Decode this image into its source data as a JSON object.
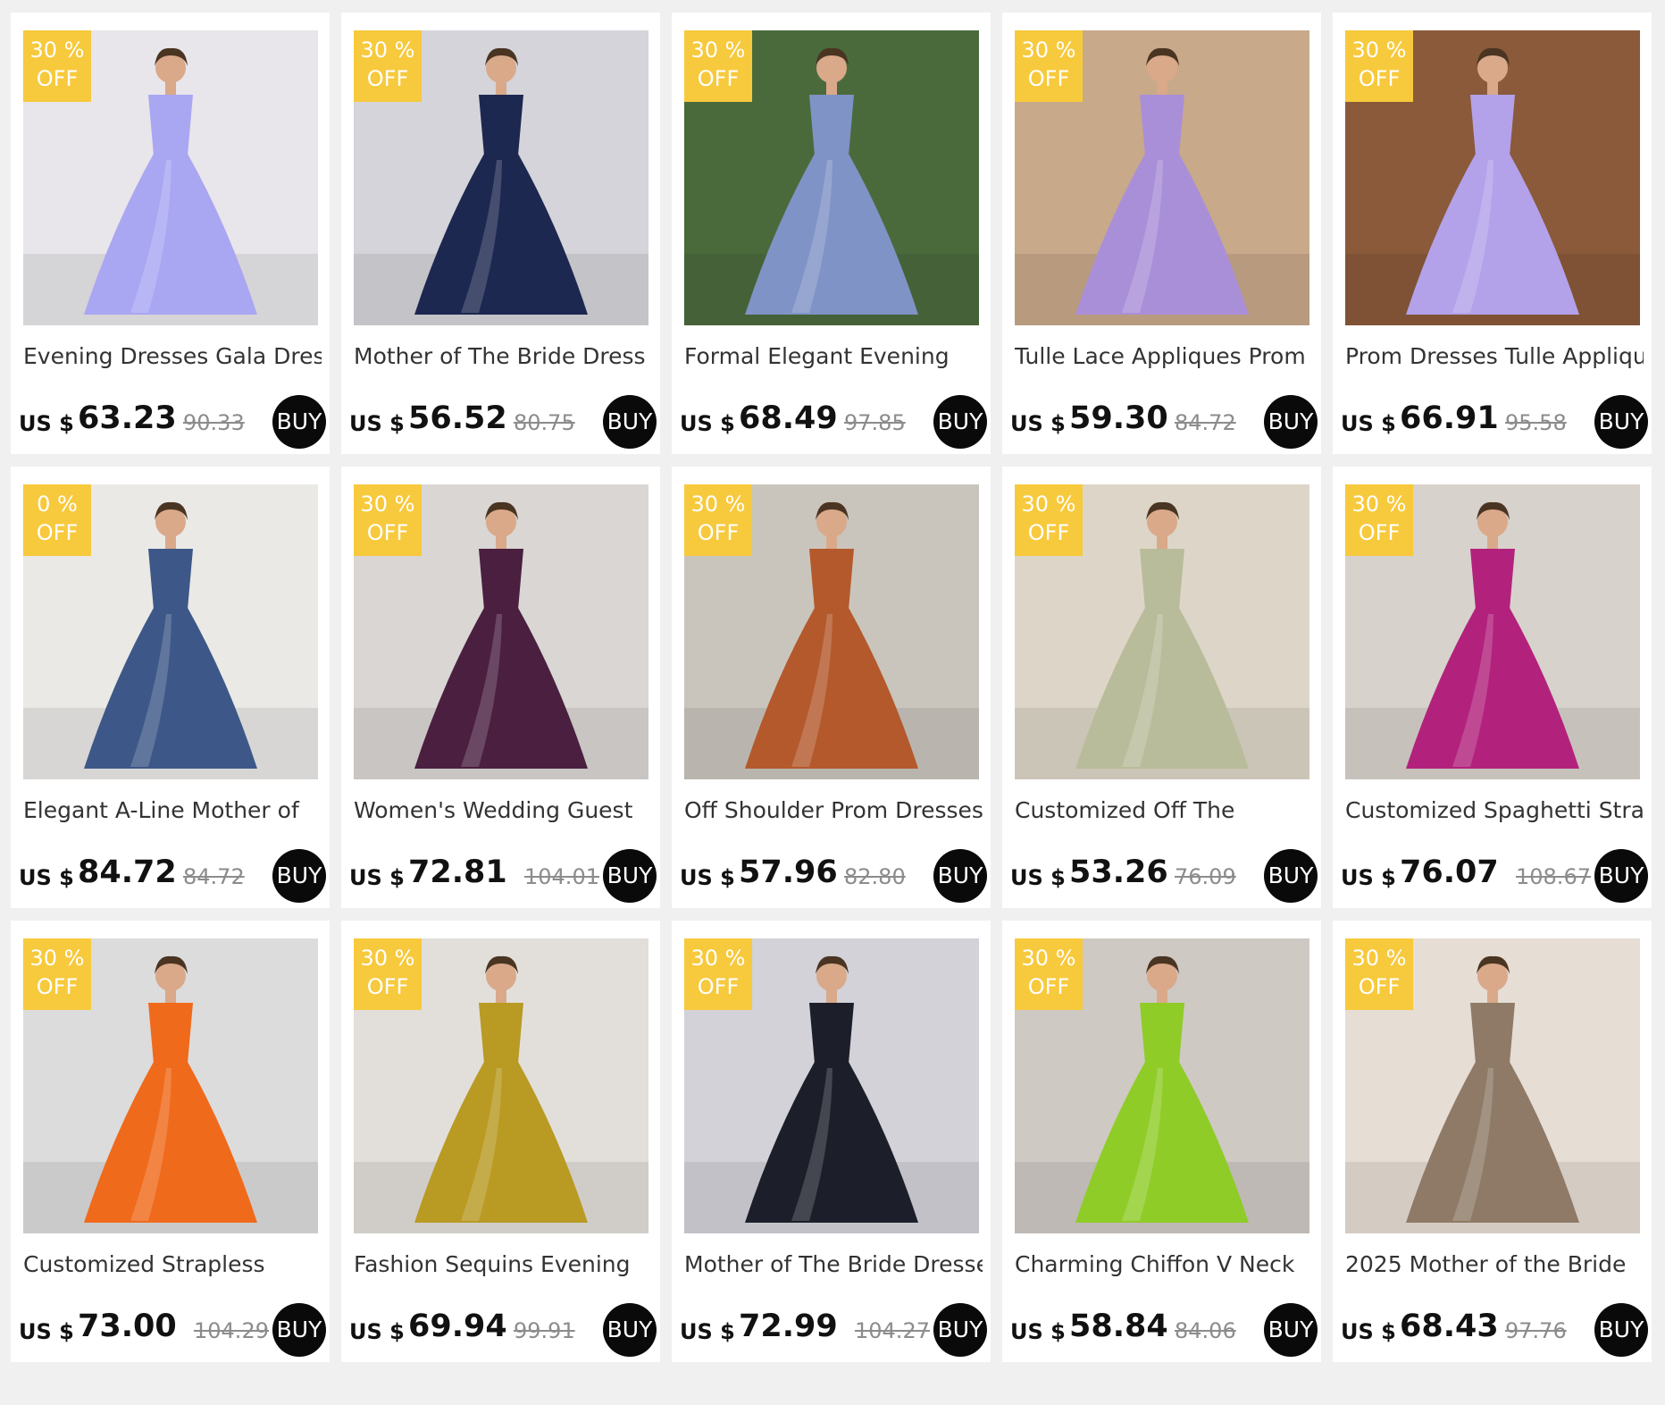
{
  "currency_label": "US $",
  "buy_label": "BUY",
  "off_label": "OFF",
  "products": [
    {
      "title": "Evening Dresses Gala Dress",
      "discount": "30 %",
      "price": "63.23",
      "old_price": "90.33",
      "dress_color": "#a9a6f2",
      "bg_color": "#e8e6ea"
    },
    {
      "title": "Mother of The Bride Dress",
      "discount": "30 %",
      "price": "56.52",
      "old_price": "80.75",
      "dress_color": "#1d2850",
      "bg_color": "#d4d4da"
    },
    {
      "title": "Formal Elegant Evening",
      "discount": "30 %",
      "price": "68.49",
      "old_price": "97.85",
      "dress_color": "#7f93c6",
      "bg_color": "#4b6a3c"
    },
    {
      "title": "Tulle Lace Appliques Prom",
      "discount": "30 %",
      "price": "59.30",
      "old_price": "84.72",
      "dress_color": "#a98fd8",
      "bg_color": "#c8a98a"
    },
    {
      "title": "Prom Dresses Tulle Applique",
      "discount": "30 %",
      "price": "66.91",
      "old_price": "95.58",
      "dress_color": "#b3a2ea",
      "bg_color": "#8a5a3a"
    },
    {
      "title": "Elegant A-Line Mother of",
      "discount": "0 %",
      "price": "84.72",
      "old_price": "84.72",
      "dress_color": "#3d5888",
      "bg_color": "#ebe9e6"
    },
    {
      "title": "Women's Wedding Guest",
      "discount": "30 %",
      "price": "72.81",
      "old_price": "104.01",
      "dress_color": "#4a1f40",
      "bg_color": "#d9d6d3"
    },
    {
      "title": "Off Shoulder Prom Dresses",
      "discount": "30 %",
      "price": "57.96",
      "old_price": "82.80",
      "dress_color": "#b4592c",
      "bg_color": "#c9c5bd"
    },
    {
      "title": "Customized Off The",
      "discount": "30 %",
      "price": "53.26",
      "old_price": "76.09",
      "dress_color": "#b9bc9a",
      "bg_color": "#ddd6c8"
    },
    {
      "title": "Customized Spaghetti Strap",
      "discount": "30 %",
      "price": "76.07",
      "old_price": "108.67",
      "dress_color": "#b2227c",
      "bg_color": "#d8d2cc"
    },
    {
      "title": "Customized Strapless",
      "discount": "30 %",
      "price": "73.00",
      "old_price": "104.29",
      "dress_color": "#f06a1c",
      "bg_color": "#dcdcdc"
    },
    {
      "title": "Fashion Sequins Evening",
      "discount": "30 %",
      "price": "69.94",
      "old_price": "99.91",
      "dress_color": "#b99a23",
      "bg_color": "#e2dfdb"
    },
    {
      "title": "Mother of The Bride Dresses",
      "discount": "30 %",
      "price": "72.99",
      "old_price": "104.27",
      "dress_color": "#1c1e2a",
      "bg_color": "#d2d2d8"
    },
    {
      "title": "Charming Chiffon V Neck",
      "discount": "30 %",
      "price": "58.84",
      "old_price": "84.06",
      "dress_color": "#8fcc28",
      "bg_color": "#cfc9c4"
    },
    {
      "title": "2025 Mother of the Bride",
      "discount": "30 %",
      "price": "68.43",
      "old_price": "97.76",
      "dress_color": "#8e7a66",
      "bg_color": "#e6ddd4"
    }
  ]
}
